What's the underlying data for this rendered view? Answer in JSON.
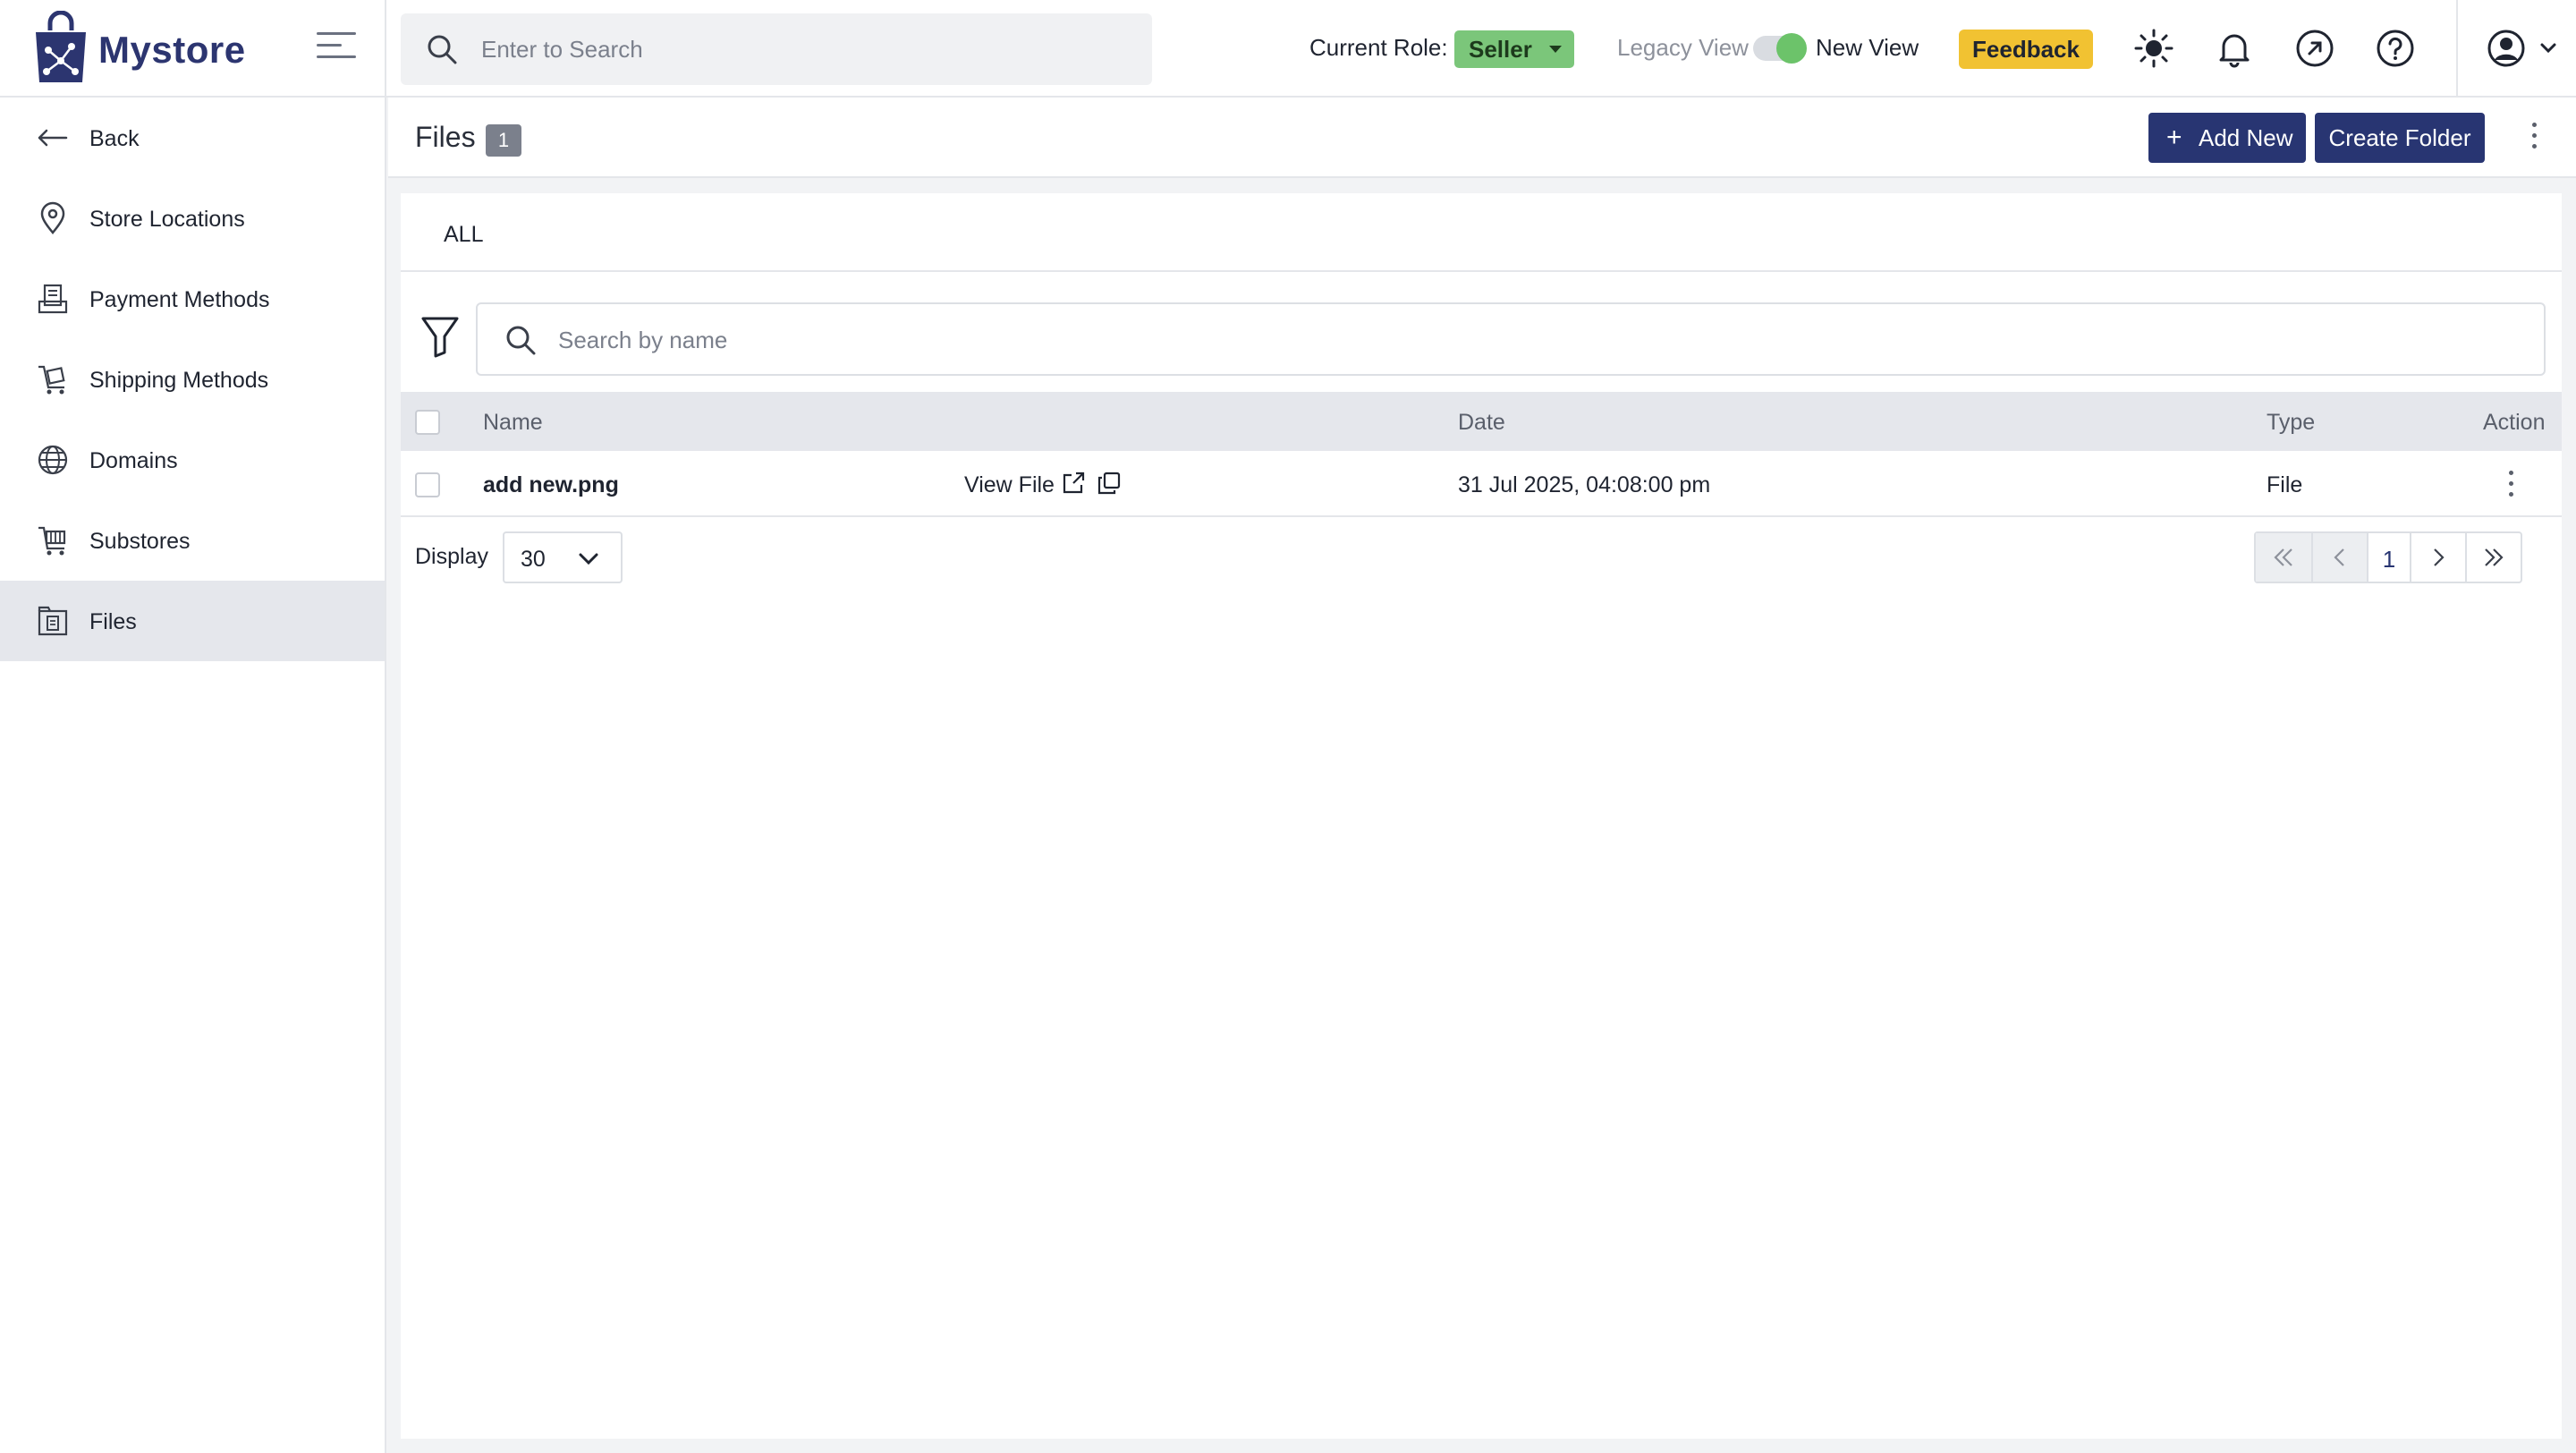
{
  "brand": {
    "name": "Mystore",
    "color": "#2c3570"
  },
  "topbar": {
    "search_placeholder": "Enter to Search",
    "role_label": "Current Role:",
    "role_value": "Seller",
    "legacy_view_label": "Legacy View",
    "new_view_label": "New View",
    "feedback_label": "Feedback"
  },
  "sidebar": {
    "items": [
      {
        "label": "Back",
        "icon": "arrow-left-icon"
      },
      {
        "label": "Store Locations",
        "icon": "map-pin-icon"
      },
      {
        "label": "Payment Methods",
        "icon": "payment-icon"
      },
      {
        "label": "Shipping Methods",
        "icon": "shipping-cart-icon"
      },
      {
        "label": "Domains",
        "icon": "globe-icon"
      },
      {
        "label": "Substores",
        "icon": "store-icon"
      },
      {
        "label": "Files",
        "icon": "file-icon"
      }
    ],
    "active_index": 6
  },
  "page": {
    "title": "Files",
    "count": "1",
    "add_new_label": "Add New",
    "create_folder_label": "Create Folder"
  },
  "tabs": {
    "all_label": "ALL"
  },
  "table": {
    "search_placeholder": "Search by name",
    "headers": {
      "name": "Name",
      "date": "Date",
      "type": "Type",
      "action": "Action"
    },
    "rows": [
      {
        "name": "add new.png",
        "view_label": "View File",
        "date": "31 Jul 2025, 04:08:00 pm",
        "type": "File"
      }
    ]
  },
  "footer": {
    "display_label": "Display",
    "display_value": "30",
    "current_page": "1"
  },
  "colors": {
    "primary": "#283572",
    "role_badge": "#7bc67a",
    "feedback": "#f1c232",
    "toggle_on": "#6cc36a"
  }
}
